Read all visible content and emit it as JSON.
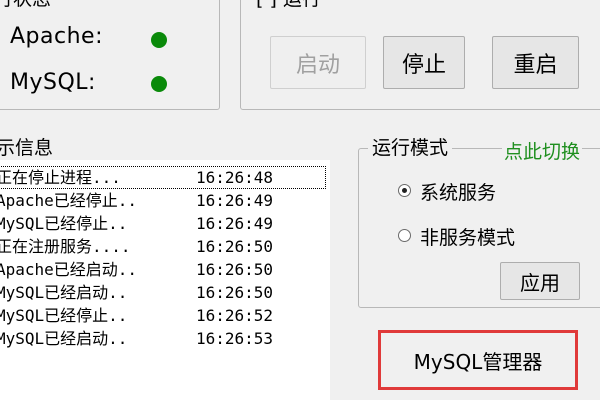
{
  "status_panel": {
    "title_partial": "行状态",
    "services": [
      {
        "label": "Apache:",
        "status_color": "#0a8a0a"
      },
      {
        "label": "MySQL:",
        "status_color": "#0a8a0a"
      }
    ]
  },
  "control_panel": {
    "title_partial": "[ ] 运行",
    "buttons": {
      "start": "启动",
      "stop": "停止",
      "restart": "重启"
    }
  },
  "log_panel": {
    "title_partial": "示信息",
    "entries": [
      {
        "msg": "正在停止进程...",
        "time": "16:26:48"
      },
      {
        "msg": "Apache已经停止..",
        "time": "16:26:49"
      },
      {
        "msg": "MySQL已经停止..",
        "time": "16:26:49"
      },
      {
        "msg": "正在注册服务....",
        "time": "16:26:50"
      },
      {
        "msg": "Apache已经启动..",
        "time": "16:26:50"
      },
      {
        "msg": "MySQL已经启动..",
        "time": "16:26:50"
      },
      {
        "msg": "MySQL已经停止..",
        "time": "16:26:52"
      },
      {
        "msg": "MySQL已经启动..",
        "time": "16:26:53"
      }
    ]
  },
  "run_mode": {
    "title": "运行模式",
    "switch_link": "点此切换",
    "options": [
      {
        "label": "系统服务",
        "checked": true
      },
      {
        "label": "非服务模式",
        "checked": false
      }
    ],
    "apply_label": "应用"
  },
  "mysql_manager_label": "MySQL管理器",
  "accent_color": "#e03a3a"
}
